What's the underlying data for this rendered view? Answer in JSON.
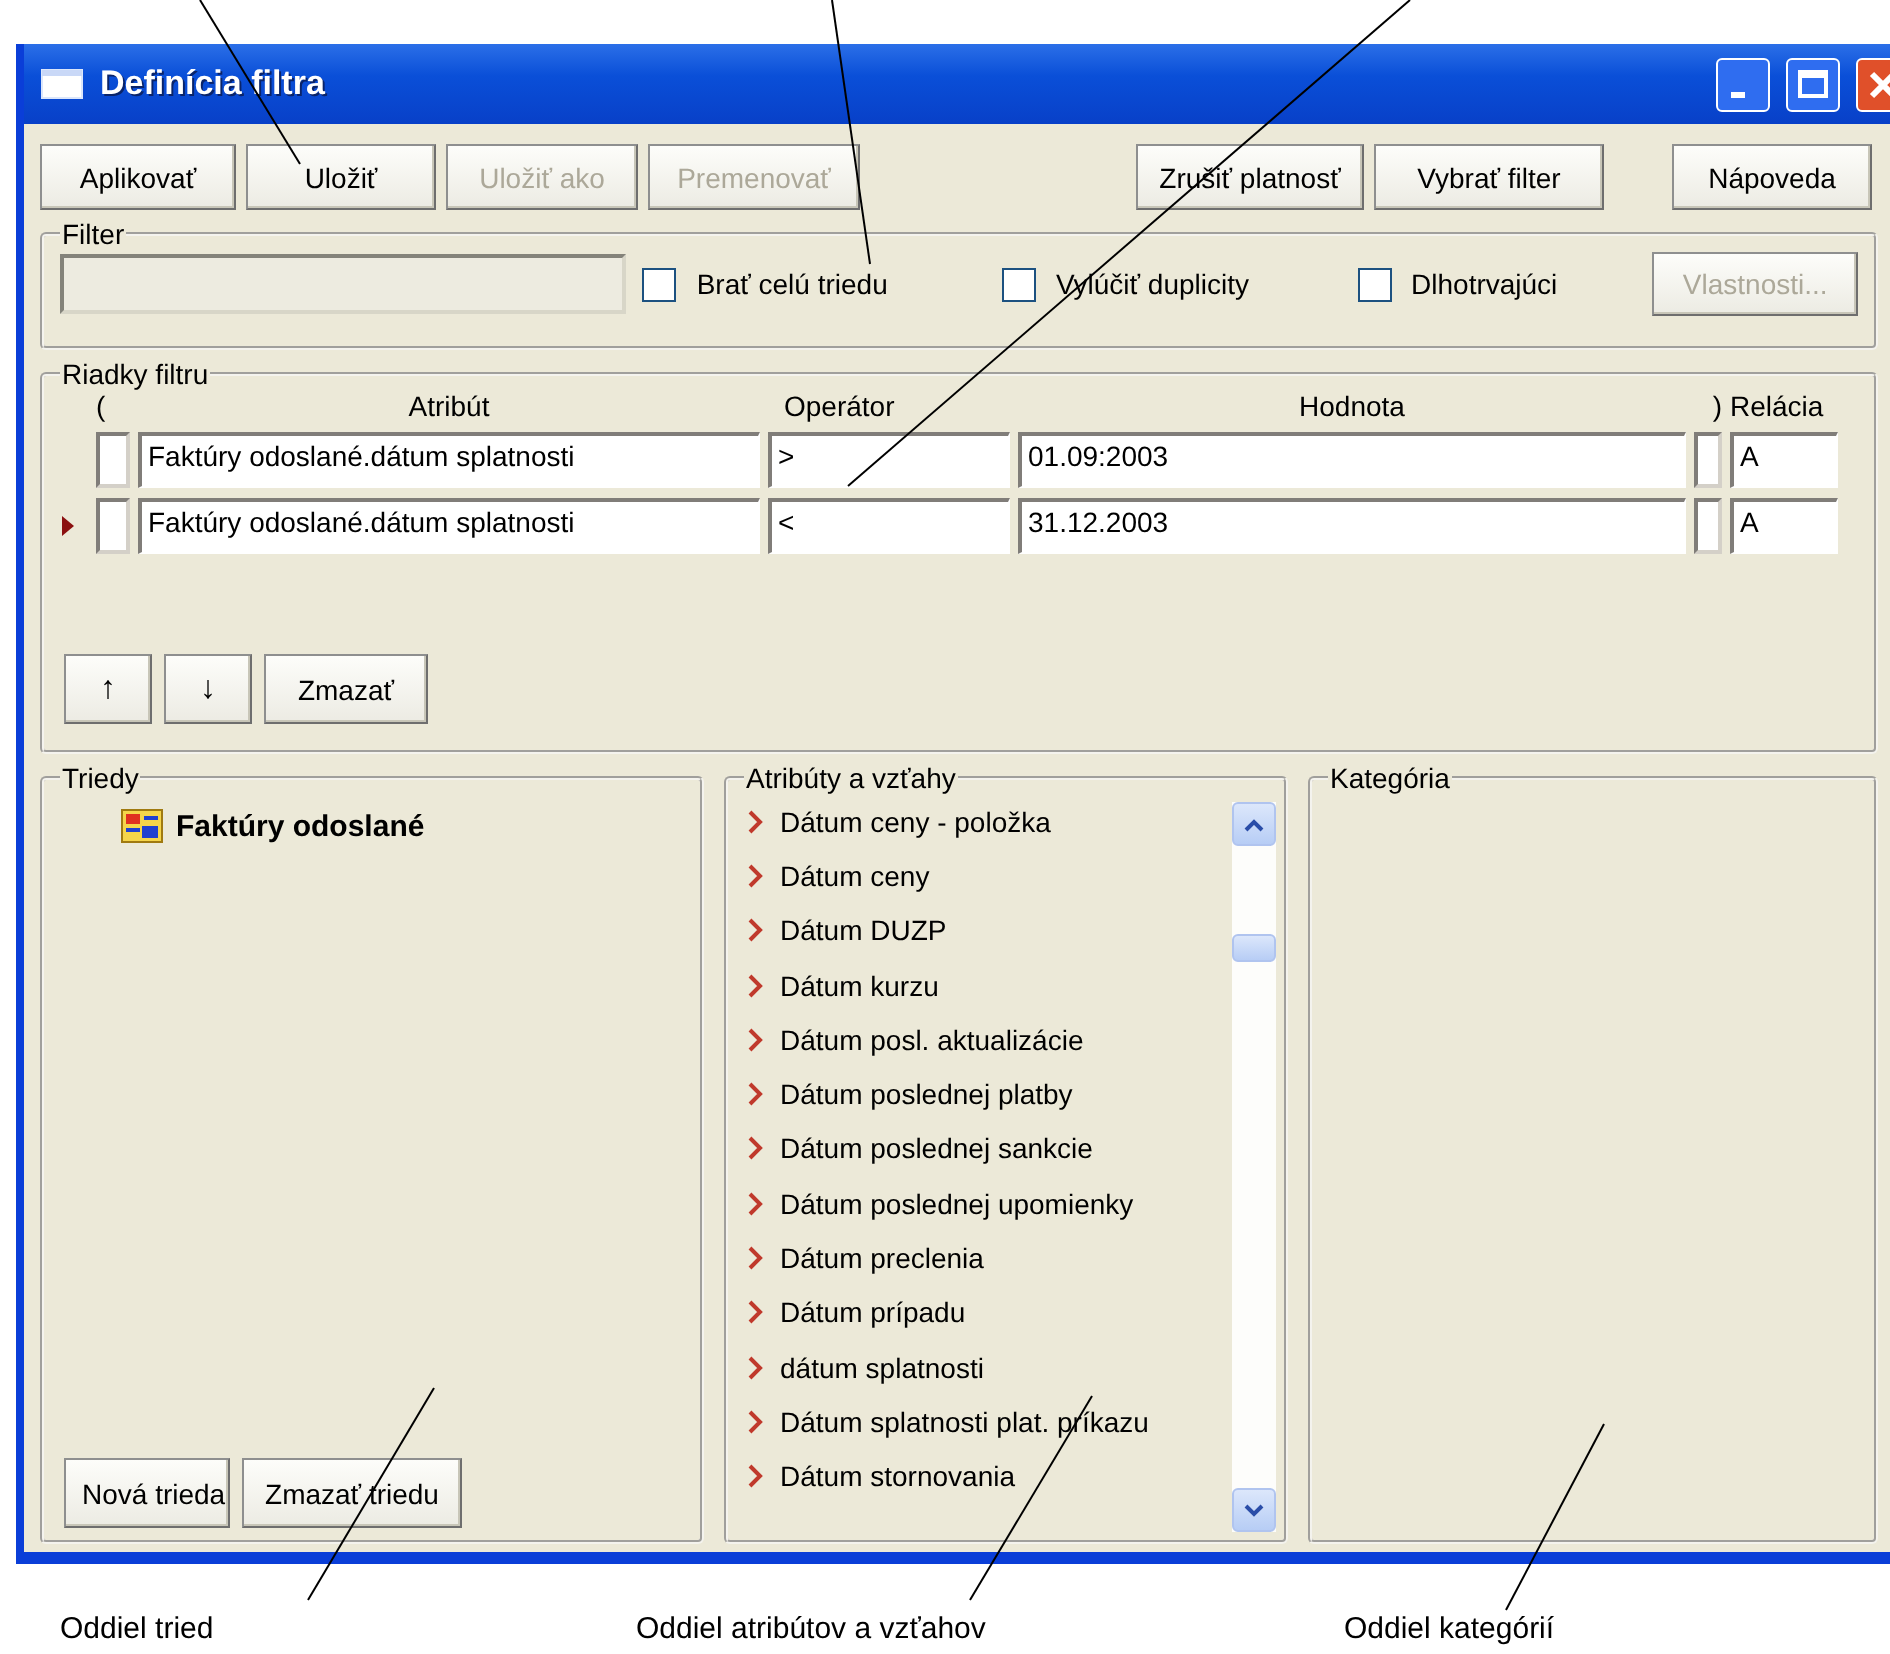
{
  "window": {
    "title": "Definícia filtra"
  },
  "toolbar": {
    "left": [
      {
        "label": "Aplikovať",
        "disabled": false
      },
      {
        "label": "Uložiť",
        "disabled": false
      },
      {
        "label": "Uložiť ako",
        "disabled": true
      },
      {
        "label": "Premenovať",
        "disabled": true
      }
    ],
    "middle": [
      {
        "label": "Zrušiť platnosť",
        "disabled": false
      },
      {
        "label": "Vybrať filter",
        "disabled": false
      }
    ],
    "right": [
      {
        "label": "Nápoveda",
        "disabled": false
      }
    ]
  },
  "filter": {
    "title": "Filter",
    "options": [
      {
        "label": "Brať celú triedu",
        "checked": false
      },
      {
        "label": "Vylúčiť duplicity",
        "checked": false
      },
      {
        "label": "Dlhotrvajúci",
        "checked": false
      }
    ],
    "properties_button": {
      "label": "Vlastnosti...",
      "disabled": true
    }
  },
  "filter_rows": {
    "title": "Riadky filtru",
    "columns": [
      "(",
      "Atribút",
      "Operátor",
      "Hodnota",
      ")",
      "Relácia"
    ],
    "rows": [
      {
        "selected": false,
        "attribute": "Faktúry odoslané.dátum splatnosti",
        "operator": ">",
        "value": "01.09:2003",
        "relation": "A"
      },
      {
        "selected": true,
        "attribute": "Faktúry odoslané.dátum splatnosti",
        "operator": "<",
        "value": "31.12.2003",
        "relation": "A"
      }
    ],
    "buttons": [
      "↑",
      "↓",
      "Zmazať"
    ]
  },
  "classes": {
    "title": "Triedy",
    "tree": [
      {
        "label": "Faktúry odoslané"
      }
    ],
    "buttons": [
      "Nová trieda",
      "Zmazať triedu"
    ]
  },
  "attributes": {
    "title": "Atribúty a vzťahy",
    "items": [
      "Dátum ceny - položka",
      "Dátum ceny",
      "Dátum DUZP",
      "Dátum kurzu",
      "Dátum posl. aktualizácie",
      "Dátum poslednej platby",
      "Dátum poslednej sankcie",
      "Dátum poslednej upomienky",
      "Dátum preclenia",
      "Dátum prípadu",
      "dátum splatnosti",
      "Dátum splatnosti plat. príkazu",
      "Dátum stornovania"
    ]
  },
  "categories": {
    "title": "Kategória"
  },
  "callouts": [
    "Oddiel tried",
    "Oddiel atribútov a vzťahov",
    "Oddiel kategórií"
  ]
}
